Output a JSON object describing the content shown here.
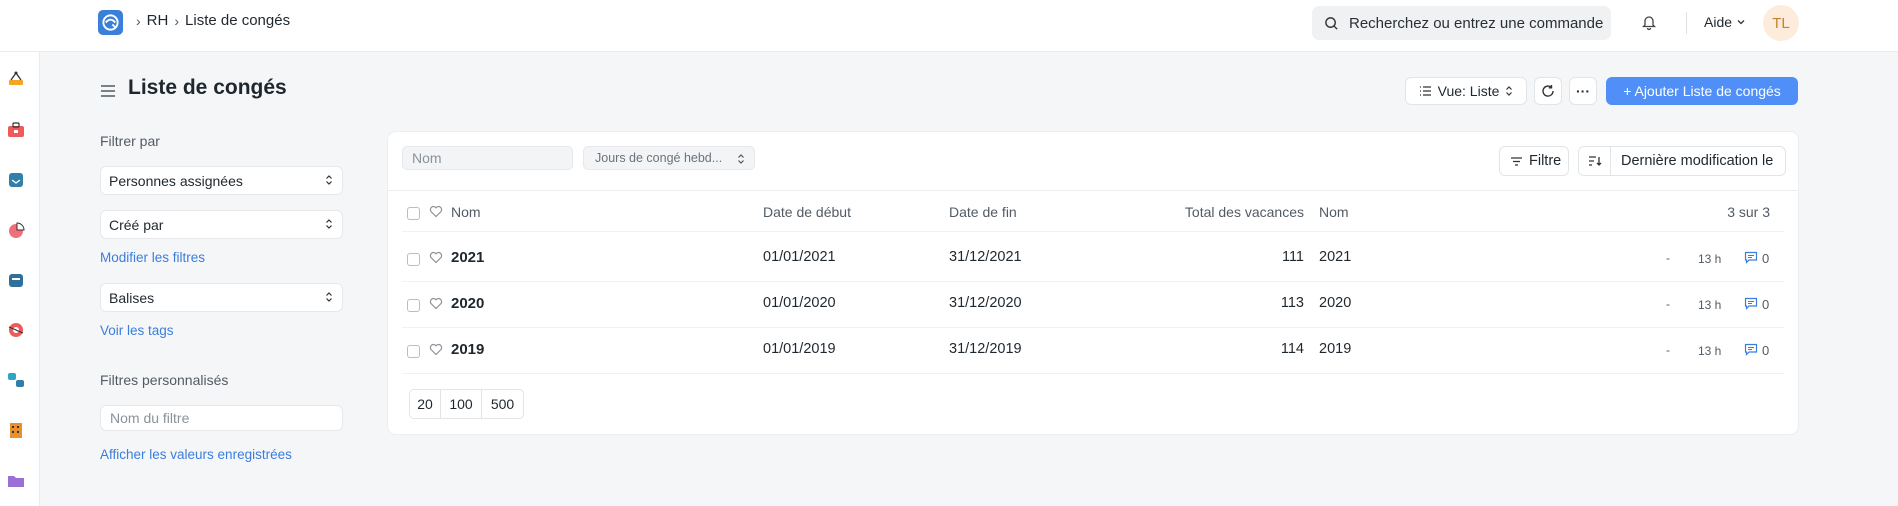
{
  "breadcrumbs": [
    "RH",
    "Liste de congés"
  ],
  "search": {
    "placeholder": "Recherchez ou entrez une commande"
  },
  "navbar": {
    "help_label": "Aide",
    "avatar_initials": "TL"
  },
  "page": {
    "title": "Liste de congés"
  },
  "toolbar": {
    "view_label": "Vue: Liste",
    "more_label": "···",
    "add_label": "+ Ajouter Liste de congés"
  },
  "sidebar": {
    "filter_by_label": "Filtrer par",
    "assigned_label": "Personnes assignées",
    "created_by_label": "Créé par",
    "edit_filters_link": "Modifier les filtres",
    "tags_label": "Balises",
    "show_tags_link": "Voir les tags",
    "custom_filters_label": "Filtres personnalisés",
    "filter_name_placeholder": "Nom du filtre",
    "show_saved_link": "Afficher les valeurs enregistrées"
  },
  "list": {
    "name_placeholder": "Nom",
    "weekly_off_label": "Jours de congé hebd...",
    "filter_label": "Filtre",
    "sort_label": "Dernière modification le",
    "columns": [
      "Nom",
      "Date de début",
      "Date de fin",
      "Total des vacances",
      "Nom"
    ],
    "count_label": "3 sur 3",
    "rows": [
      {
        "name": "2021",
        "start": "01/01/2021",
        "end": "31/12/2021",
        "total": "111",
        "name2": "2021",
        "dash": "-",
        "time": "13 h",
        "comments": "0"
      },
      {
        "name": "2020",
        "start": "01/01/2020",
        "end": "31/12/2020",
        "total": "113",
        "name2": "2020",
        "dash": "-",
        "time": "13 h",
        "comments": "0"
      },
      {
        "name": "2019",
        "start": "01/01/2019",
        "end": "31/12/2019",
        "total": "114",
        "name2": "2019",
        "dash": "-",
        "time": "13 h",
        "comments": "0"
      }
    ],
    "page_sizes": [
      "20",
      "100",
      "500"
    ]
  },
  "colors": {
    "accent": "#4f8ff7",
    "link": "#3b7ddd"
  }
}
